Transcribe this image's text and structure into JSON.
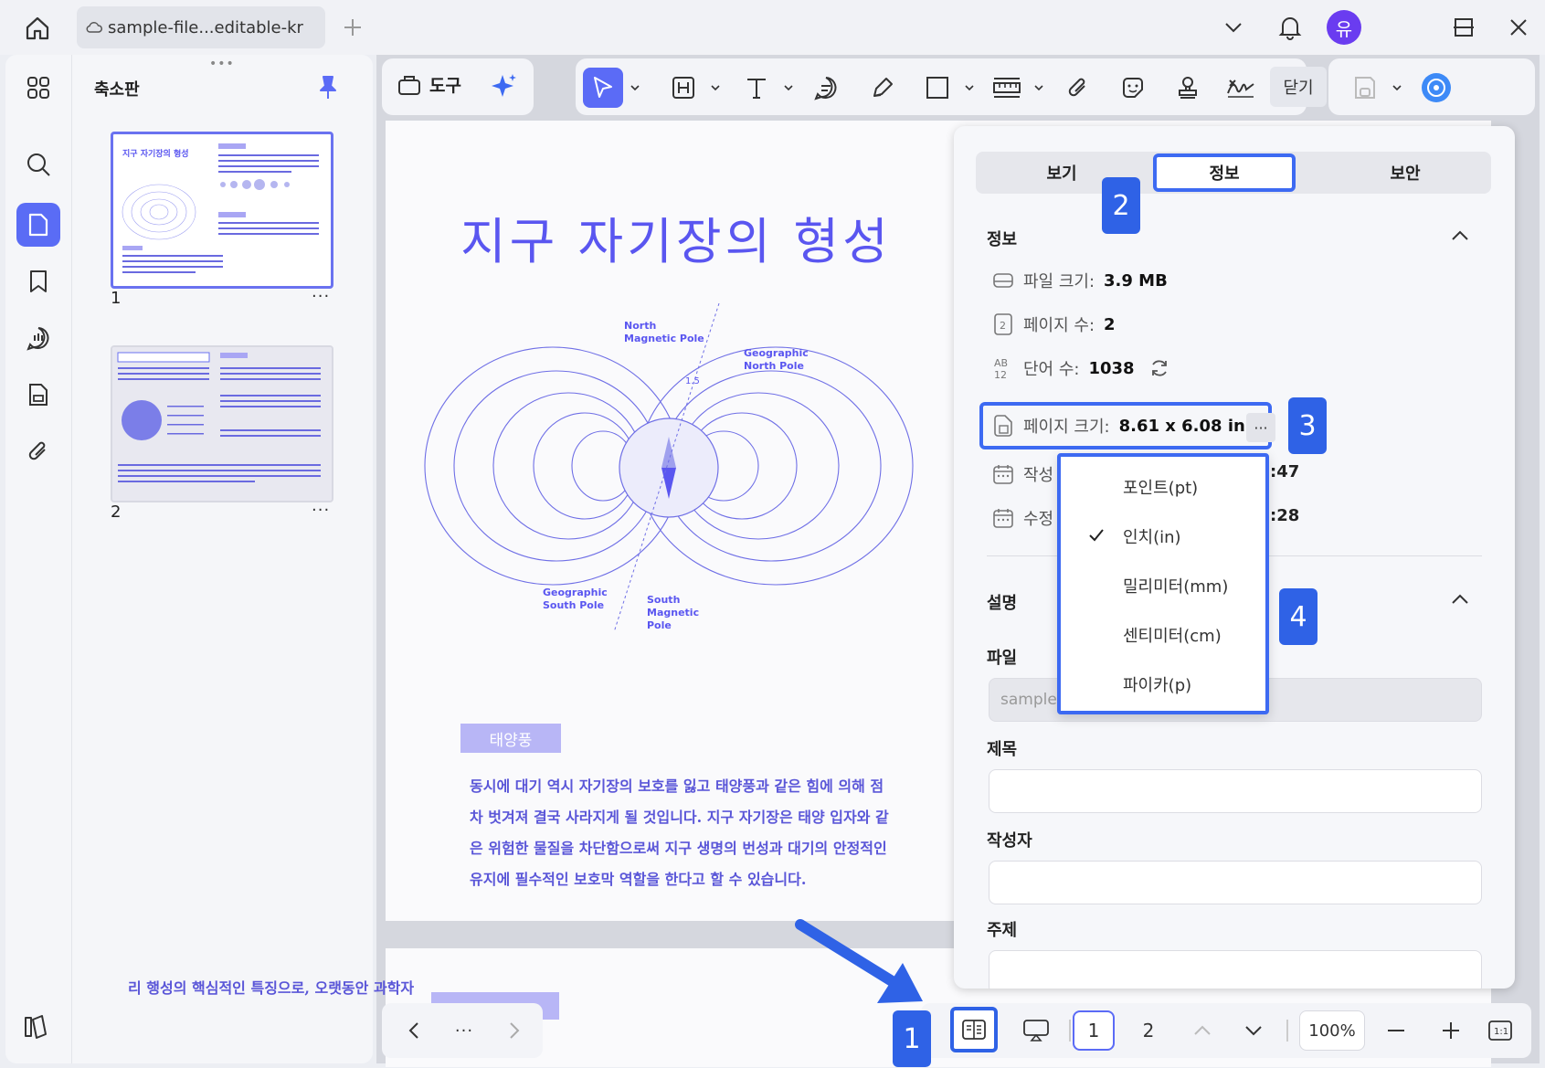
{
  "titlebar": {
    "file_tab_label": "sample-file...editable-kr",
    "avatar_initial": "유"
  },
  "thumbnails": {
    "title": "축소판",
    "pages": [
      {
        "number": "1",
        "more": "···"
      },
      {
        "number": "2",
        "more": "···"
      }
    ]
  },
  "toolbar": {
    "tools_label": "도구",
    "close_label": "닫기"
  },
  "document": {
    "title": "지구 자기장의 형성",
    "diagram_labels": {
      "north_magnetic": "North Magnetic Pole",
      "geographic_north": "Geographic North Pole",
      "geographic_south": "Geographic South Pole",
      "south_magnetic": "South Magnetic Pole",
      "angle": "1.5"
    },
    "section_tag": "태양풍",
    "paragraph_lines": [
      "동시에 대기 역시 자기장의 보호를 잃고 태양풍과 같은 힘에 의해 점",
      "차 벗겨져 결국 사라지게 될 것입니다. 지구 자기장은 태양 입자와 같",
      "은 위험한 물질을 차단함으로써 지구 생명의 번성과 대기의 안정적인",
      "유지에 필수적인 보호막 역할을 한다고 할 수 있습니다."
    ],
    "page2_line": "리 행성의 핵심적인 특징으로, 오랫동안 과학자"
  },
  "info_panel": {
    "tabs": [
      "보기",
      "정보",
      "보안"
    ],
    "active_tab": "정보",
    "info_heading": "정보",
    "file_size_label": "파일 크기:",
    "file_size_value": "3.9 MB",
    "page_count_label": "페이지 수:",
    "page_count_value": "2",
    "word_count_label": "단어 수:",
    "word_count_value": "1038",
    "page_size_label": "페이지 크기:",
    "page_size_value": "8.61 x 6.08 in",
    "created_label": "작성",
    "created_time_suffix": ":47",
    "modified_label": "수정",
    "modified_time_suffix": ":28",
    "description_heading": "설명",
    "file_label": "파일",
    "file_value": "sample-",
    "title_label": "제목",
    "author_label": "작성자",
    "subject_label": "주제"
  },
  "unit_menu": {
    "items": [
      "포인트(pt)",
      "인치(in)",
      "밀리미터(mm)",
      "센티미터(cm)",
      "파이카(p)"
    ],
    "selected": "인치(in)"
  },
  "badges": [
    "1",
    "2",
    "3",
    "4"
  ],
  "bottom_bar": {
    "page_1": "1",
    "page_2": "2",
    "zoom": "100%",
    "more": "···",
    "actual_size": "1:1"
  },
  "colors": {
    "accent": "#3d6af2",
    "doc_text": "#5a56f0",
    "active_tool": "#5b6bf6"
  }
}
